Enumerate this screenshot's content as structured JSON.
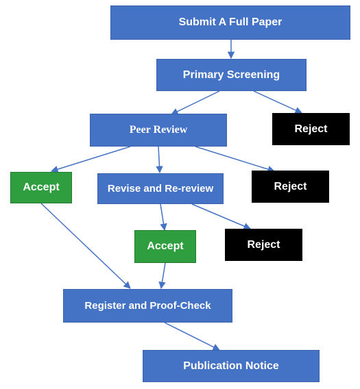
{
  "nodes": {
    "submit": {
      "label": "Submit A Full Paper"
    },
    "primary": {
      "label": "Primary Screening"
    },
    "reject1": {
      "label": "Reject"
    },
    "peer": {
      "label": "Peer Review"
    },
    "accept1": {
      "label": "Accept"
    },
    "revise": {
      "label": "Revise and Re-review"
    },
    "reject2": {
      "label": "Reject"
    },
    "accept2": {
      "label": "Accept"
    },
    "reject3": {
      "label": "Reject"
    },
    "register": {
      "label": "Register and Proof-Check"
    },
    "publication": {
      "label": "Publication Notice"
    }
  },
  "flow": {
    "type": "workflow",
    "edges": [
      [
        "submit",
        "primary"
      ],
      [
        "primary",
        "peer"
      ],
      [
        "primary",
        "reject1"
      ],
      [
        "peer",
        "accept1"
      ],
      [
        "peer",
        "revise"
      ],
      [
        "peer",
        "reject2"
      ],
      [
        "revise",
        "accept2"
      ],
      [
        "revise",
        "reject3"
      ],
      [
        "accept1",
        "register"
      ],
      [
        "accept2",
        "register"
      ],
      [
        "register",
        "publication"
      ]
    ]
  },
  "colors": {
    "blue": "#4472c4",
    "green": "#2e9e3f",
    "black": "#000000",
    "arrow": "#4472c4"
  }
}
